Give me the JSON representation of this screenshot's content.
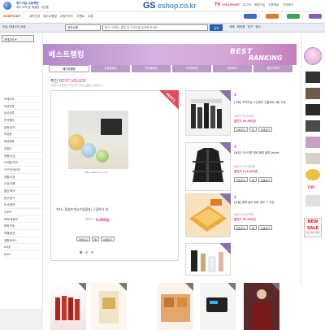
{
  "top": {
    "promo_line1": "정기가입 쇼핑폭탄",
    "promo_line2": "최다고객 중 특별한 사은품",
    "logo_main": "GS",
    "logo_sub": "eshop",
    "logo_tld": ".co.kr",
    "tv_label": "TV",
    "util_links": [
      "로그인",
      "회원가입",
      "주문배송",
      "고객센터",
      "장바구니"
    ],
    "util_highlight": "GS&POINT"
  },
  "nav": {
    "home_label": "GS&POINT",
    "links": [
      "대박신상",
      "베스트랭킹",
      "쇼핑가이드",
      "이벤트",
      "쿠폰"
    ]
  },
  "search": {
    "left_label": "오늘 카테고리 쇼핑",
    "select_value": "일반상품",
    "placeholder": "행사, 이벤트, 할인 등 키워드를 입력해 보세요.",
    "button_label": "검색",
    "hot_keywords": [
      "세제",
      "화장품",
      "침구",
      "생수"
    ]
  },
  "sidebar": {
    "category_button": "카테고리"
  },
  "banner": {
    "title": "베스트랭킹",
    "best": "BEST",
    "ranking": "RANKING"
  },
  "tabs": [
    {
      "label": "베스트랭킹",
      "active": true
    },
    {
      "label": "상품별랭킹",
      "active": false
    },
    {
      "label": "연령별랭킹",
      "active": false
    },
    {
      "label": "고객별랭킹",
      "active": false
    },
    {
      "label": "랭킹토크",
      "active": false
    },
    {
      "label": "랭킹스토어",
      "active": false
    }
  ],
  "categories": [
    "카테고리",
    "여성의류",
    "남성의류",
    "언더웨어",
    "잡화/슈즈",
    "화장품",
    "패션잡화",
    "쥬얼리",
    "명품/수입",
    "디지털/가전",
    "가구/인테리어",
    "생활/주방",
    "건강/식품",
    "출산/육아",
    "완구/문구",
    "도서/음반",
    "스포츠",
    "레저/자동차",
    "해외구매",
    "여행/공연",
    "생활서비스",
    "e쿠폰",
    "plain"
  ],
  "section": {
    "title_prefix": "주간",
    "title_accent": "BEST SELLER",
    "desc": "이번주 GS샵에서 가장 많이 팔린 상품을 소개합니다."
  },
  "featured": {
    "rank": "BEST1",
    "url_caption": "http://www.xxx.co.kr",
    "name": "기타 / 털실뜨개(5수입털실) 구경하기 외",
    "price_label": "판매가",
    "price": "9,900원",
    "buttons": [
      "장바구니",
      "찜",
      "상세보기"
    ]
  },
  "ranks": [
    {
      "num": "2",
      "name": "[기획] 프리미엄 스킨케어 선물세트 5종 구성",
      "orig": "정상가 39,900원",
      "price": "할인가 29,900원"
    },
    {
      "num": "3",
      "name": "[남성] 구스다운 헤비 패딩 점퍼 Jacket",
      "orig": "정상가 159,000원",
      "price": "할인가 119,000원"
    },
    {
      "num": "4",
      "name": "[아동] 원목 놀이 매트 세트 + 쿠션",
      "orig": "정상가 49,900원",
      "price": "할인가 39,900원"
    }
  ],
  "rank_buttons": [
    "장바구니",
    "찜",
    "상세보기"
  ],
  "rail": {
    "top_label": "TOP",
    "sale_label": "NEW SALE",
    "sale_sub": "지금 바로 확인"
  },
  "colors": {
    "brand": "#1d4f91",
    "accent": "#e03a8c",
    "banner": "#c69ad6",
    "tab": "#b99acb"
  }
}
